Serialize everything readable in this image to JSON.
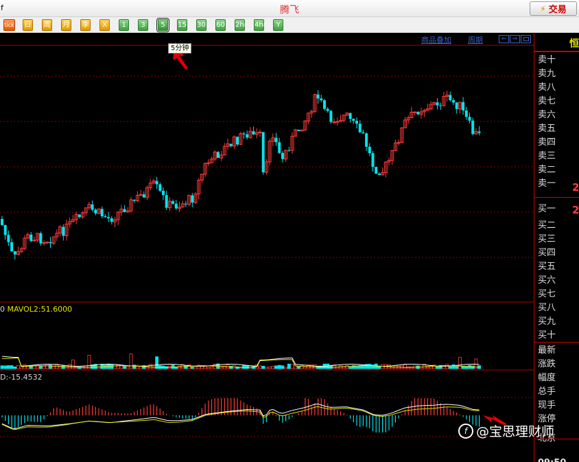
{
  "window": {
    "title": "腾飞",
    "left_mark": "f",
    "trade_button": "交易",
    "trade_icon": "lightning-icon"
  },
  "toolbar": {
    "buttons": [
      "tick",
      "日",
      "周",
      "月",
      "季",
      "X",
      "1",
      "3",
      "5",
      "15",
      "30",
      "60",
      "2hr",
      "4hr",
      "Y"
    ],
    "selected": "5"
  },
  "tooltip": "5分钟",
  "chart_links": [
    "商品叠加",
    "周期"
  ],
  "chart_nav_icons": [
    "arrow-left-icon",
    "arrow-right-icon",
    "window-icon"
  ],
  "volume": {
    "label": "0",
    "ma2_label": "MAVOL2:51.6000"
  },
  "macd": {
    "label": "D:-15.4532"
  },
  "panel": {
    "header": "恒",
    "asks": [
      "卖十",
      "卖九",
      "卖八",
      "卖七",
      "卖六",
      "卖五",
      "卖四",
      "卖三",
      "卖二",
      "卖一"
    ],
    "bids": [
      "买一",
      "买二",
      "买三",
      "买四",
      "买五",
      "买六",
      "买七",
      "买八",
      "买九",
      "买十"
    ],
    "ask1_value": "2",
    "bid1_value": "2",
    "stats": [
      "最新",
      "涨跌",
      "幅度",
      "总手",
      "现手",
      "涨停",
      "北京"
    ],
    "time": "09:50"
  },
  "watermark": "@宝思理财师",
  "colors": {
    "up": "#ff3b3b",
    "down": "#00e5ee",
    "grid": "#8b0000",
    "ma1": "#ffffff",
    "ma2": "#e6e600",
    "accent": "#cc0000"
  }
}
